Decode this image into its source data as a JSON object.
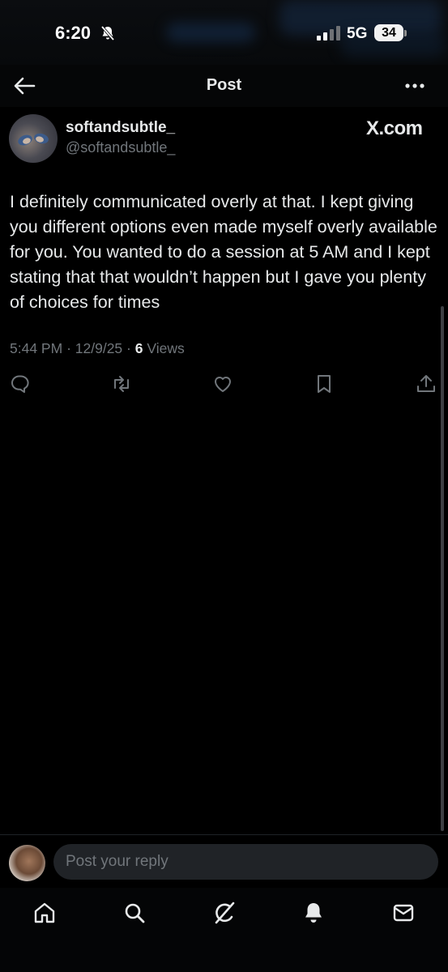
{
  "status_bar": {
    "time": "6:20",
    "network": "5G",
    "battery": "34"
  },
  "header": {
    "title": "Post"
  },
  "post": {
    "display_name": "softandsubtle_",
    "handle": "@softandsubtle_",
    "watermark": "X.com",
    "text": "I definitely communicated overly at that. I kept giving you different options even made myself overly available for you. You wanted to do a session at 5 AM and I kept stating that that wouldn’t happen but I gave you plenty of choices for times",
    "time": "5:44 PM",
    "date": "12/9/25",
    "separator": "·",
    "views_count": "6",
    "views_label": "Views"
  },
  "reply": {
    "placeholder": "Post your reply"
  },
  "icons": {
    "back": "arrow-left-icon",
    "more": "more-horizontal-icon",
    "reply": "comment-icon",
    "repost": "repost-icon",
    "like": "heart-icon",
    "bookmark": "bookmark-icon",
    "share": "share-icon",
    "nav": [
      "home-icon",
      "search-icon",
      "grok-icon",
      "notifications-icon",
      "messages-icon"
    ]
  },
  "colors": {
    "background": "#000000",
    "text": "#e7e9ea",
    "muted": "#71767b",
    "input_bg": "#202327"
  }
}
